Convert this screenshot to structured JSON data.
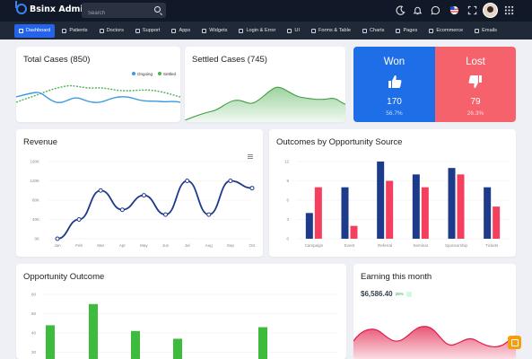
{
  "app": {
    "brand": "Bsinx Admin",
    "search_placeholder": "Search"
  },
  "topbar_icons": [
    "moon-icon",
    "bell-icon",
    "chat-icon",
    "flag-icon",
    "fullscreen-icon",
    "avatar",
    "apps-icon"
  ],
  "nav": {
    "items": [
      {
        "label": "Dashboard",
        "icon": "dashboard-icon"
      },
      {
        "label": "Patients",
        "icon": "patients-icon"
      },
      {
        "label": "Doctors",
        "icon": "doctors-icon"
      },
      {
        "label": "Support",
        "icon": "support-icon"
      },
      {
        "label": "Apps",
        "icon": "apps-icon"
      },
      {
        "label": "Widgets",
        "icon": "widgets-icon"
      },
      {
        "label": "Login & Error",
        "icon": "lock-icon"
      },
      {
        "label": "UI",
        "icon": "ui-icon"
      },
      {
        "label": "Forms & Table",
        "icon": "forms-icon"
      },
      {
        "label": "Charts",
        "icon": "charts-icon"
      },
      {
        "label": "Pages",
        "icon": "pages-icon"
      },
      {
        "label": "Ecommerce",
        "icon": "cart-icon"
      },
      {
        "label": "Emails",
        "icon": "mail-icon"
      }
    ],
    "active": "Dashboard"
  },
  "cards": {
    "total_cases": {
      "title": "Total Cases (850)",
      "legend": [
        {
          "name": "Ongoing",
          "color": "#3b9ae1"
        },
        {
          "name": "Settled",
          "color": "#4caf50"
        }
      ]
    },
    "settled_cases": {
      "title": "Settled Cases (745)"
    },
    "won": {
      "label": "Won",
      "value": "170",
      "percent": "56.7%",
      "color": "#1e6ee8"
    },
    "lost": {
      "label": "Lost",
      "value": "79",
      "percent": "26.3%",
      "color": "#f6626c"
    },
    "revenue": {
      "title": "Revenue"
    },
    "opportunity_source": {
      "title": "Outcomes by Opportunity Source"
    },
    "opportunity_outcome": {
      "title": "Opportunity Outcome"
    },
    "earning": {
      "title": "Earning this month",
      "value": "$6,586.40",
      "change": "25%"
    }
  },
  "chart_data": [
    {
      "id": "revenue",
      "type": "line",
      "categories": [
        "Jan",
        "Feb",
        "Mar",
        "Apr",
        "May",
        "Jun",
        "Jul",
        "Aug",
        "Sep",
        "Oct"
      ],
      "values": [
        0,
        40,
        100,
        60,
        90,
        50,
        120,
        50,
        120,
        105
      ],
      "yticks": [
        "0K",
        "40K",
        "80K",
        "120K",
        "160K"
      ],
      "ylim": [
        0,
        160
      ],
      "color": "#1e3a8a"
    },
    {
      "id": "opportunity_source",
      "type": "bar",
      "categories": [
        "Campaign",
        "Event",
        "Referral",
        "Seminar",
        "Sponsorship",
        "Tickets"
      ],
      "yticks": [
        "0",
        "3",
        "6",
        "9",
        "12"
      ],
      "ylim": [
        0,
        12
      ],
      "series": [
        {
          "values": [
            4,
            8,
            12,
            10,
            11,
            8
          ],
          "color": "#1e3a8a"
        },
        {
          "values": [
            8,
            2,
            9,
            8,
            10,
            5
          ],
          "color": "#f43f5e"
        }
      ],
      "extra_bars": [
        {
          "category": "Seminar",
          "value": 10
        },
        {
          "category": "Tickets",
          "value": 2
        }
      ]
    },
    {
      "id": "opportunity_outcome",
      "type": "bar",
      "yticks": [
        "30",
        "40",
        "50",
        "60"
      ],
      "values": [
        44,
        55,
        41,
        37,
        43
      ],
      "color": "#3dbb3d"
    }
  ]
}
